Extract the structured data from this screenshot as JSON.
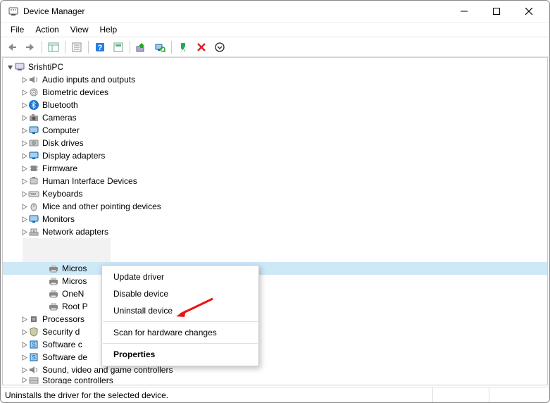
{
  "window": {
    "title": "Device Manager"
  },
  "menubar": [
    "File",
    "Action",
    "View",
    "Help"
  ],
  "root": {
    "label": "SrishtiPC"
  },
  "categories": [
    {
      "label": "Audio inputs and outputs",
      "icon": "speaker"
    },
    {
      "label": "Biometric devices",
      "icon": "fingerprint"
    },
    {
      "label": "Bluetooth",
      "icon": "bluetooth"
    },
    {
      "label": "Cameras",
      "icon": "camera"
    },
    {
      "label": "Computer",
      "icon": "monitor"
    },
    {
      "label": "Disk drives",
      "icon": "disk"
    },
    {
      "label": "Display adapters",
      "icon": "monitor"
    },
    {
      "label": "Firmware",
      "icon": "chip"
    },
    {
      "label": "Human Interface Devices",
      "icon": "hid"
    },
    {
      "label": "Keyboards",
      "icon": "keyboard"
    },
    {
      "label": "Mice and other pointing devices",
      "icon": "mouse"
    },
    {
      "label": "Monitors",
      "icon": "monitor"
    },
    {
      "label": "Network adapters",
      "icon": "network"
    }
  ],
  "printers": [
    {
      "label": "Micros",
      "icon": "printer",
      "selected": true
    },
    {
      "label": "Micros",
      "icon": "printer"
    },
    {
      "label": "OneN",
      "icon": "printer"
    },
    {
      "label": "Root P",
      "icon": "printer"
    }
  ],
  "tail": [
    {
      "label": "Processors",
      "icon": "cpu",
      "truncated": true
    },
    {
      "label": "Security d",
      "icon": "shield",
      "truncated": true
    },
    {
      "label": "Software c",
      "icon": "software",
      "truncated": true
    },
    {
      "label": "Software de",
      "icon": "software",
      "truncated_after_menu": true
    },
    {
      "label": "Sound, video and game controllers",
      "icon": "speaker"
    },
    {
      "label": "Storage controllers",
      "icon": "storage",
      "cut": true
    }
  ],
  "context_menu": [
    {
      "label": "Update driver"
    },
    {
      "label": "Disable device"
    },
    {
      "label": "Uninstall device"
    },
    {
      "sep": true
    },
    {
      "label": "Scan for hardware changes"
    },
    {
      "sep": true
    },
    {
      "label": "Properties",
      "bold": true
    }
  ],
  "status": "Uninstalls the driver for the selected device."
}
